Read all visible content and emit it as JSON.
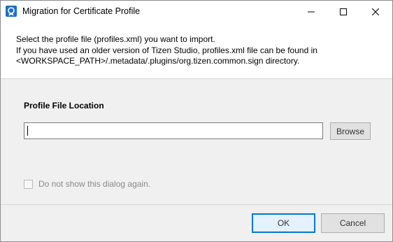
{
  "window": {
    "title": "Migration for Certificate Profile",
    "icon": "certificate-app-icon",
    "controls": {
      "minimize": "minimize-icon",
      "maximize": "maximize-icon",
      "close": "close-icon"
    }
  },
  "header": {
    "line1": "Select the profile file (profiles.xml) you want to import.",
    "line2": "If you have used an older version of Tizen Studio, profiles.xml file can be found in",
    "line3": "<WORKSPACE_PATH>/.metadata/.plugins/org.tizen.common.sign directory."
  },
  "form": {
    "section_label": "Profile File Location",
    "path_value": "",
    "path_placeholder": "",
    "browse_label": "Browse",
    "dont_show_label": "Do not show this dialog again.",
    "dont_show_checked": false,
    "dont_show_enabled": false
  },
  "footer": {
    "ok_label": "OK",
    "cancel_label": "Cancel"
  },
  "colors": {
    "focus_border": "#0078d7",
    "title_icon_bg": "#1e6fc5",
    "disabled_text": "#8a8a8a"
  }
}
